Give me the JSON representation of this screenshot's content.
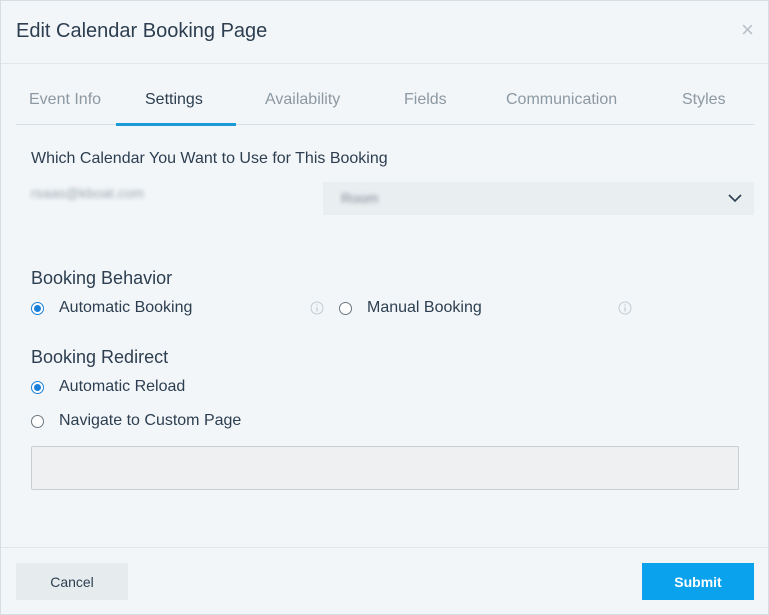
{
  "dialog": {
    "title": "Edit Calendar Booking Page",
    "close_glyph": "×"
  },
  "tabs": [
    {
      "label": "Event Info",
      "active": false
    },
    {
      "label": "Settings",
      "active": true
    },
    {
      "label": "Availability",
      "active": false
    },
    {
      "label": "Fields",
      "active": false
    },
    {
      "label": "Communication",
      "active": false
    },
    {
      "label": "Styles",
      "active": false
    }
  ],
  "calendar": {
    "label": "Which Calendar You Want to Use for This Booking",
    "email": "rsaas@kboat.com",
    "selected": "Room"
  },
  "behavior": {
    "heading": "Booking Behavior",
    "options": [
      {
        "label": "Automatic Booking",
        "checked": true
      },
      {
        "label": "Manual Booking",
        "checked": false
      }
    ]
  },
  "redirect": {
    "heading": "Booking Redirect",
    "options": [
      {
        "label": "Automatic Reload",
        "checked": true
      },
      {
        "label": "Navigate to Custom Page",
        "checked": false
      }
    ],
    "custom_url_value": ""
  },
  "footer": {
    "cancel_label": "Cancel",
    "submit_label": "Submit"
  },
  "colors": {
    "accent": "#1a9bd7",
    "submit": "#0aa2ec"
  },
  "icons": {
    "close": "close-icon",
    "dropdown": "chevron-down-icon",
    "info": "info-icon"
  }
}
